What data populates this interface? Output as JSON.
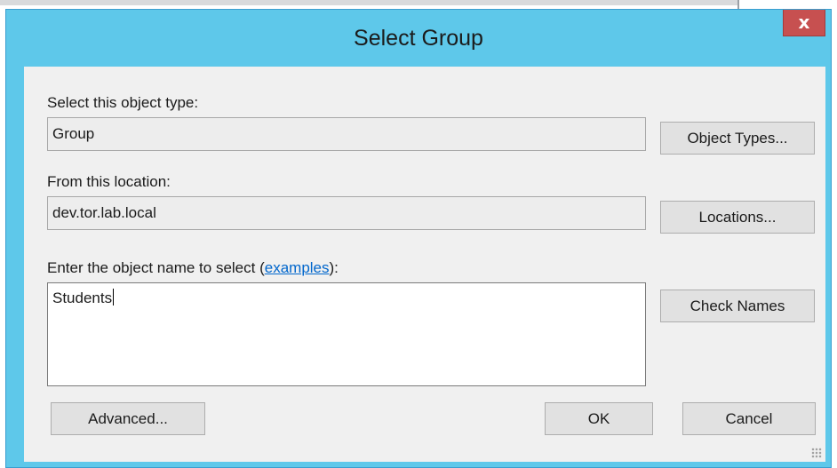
{
  "dialog": {
    "title": "Select Group",
    "close_label": "x"
  },
  "object_type": {
    "label": "Select this object type:",
    "value": "Group",
    "button_label": "Object Types..."
  },
  "location": {
    "label": "From this location:",
    "value": "dev.tor.lab.local",
    "button_label": "Locations..."
  },
  "object_name": {
    "label_prefix": "Enter the object name to select (",
    "label_link": "examples",
    "label_suffix": "):",
    "value": "Students",
    "check_names_label": "Check Names"
  },
  "footer": {
    "advanced_label": "Advanced...",
    "ok_label": "OK",
    "cancel_label": "Cancel"
  },
  "colors": {
    "title_bar": "#5ec8ea",
    "close_button": "#c75050",
    "link": "#0066cc"
  },
  "icons": {
    "close": "close-icon",
    "resize_grip": "resize-grip-icon"
  }
}
